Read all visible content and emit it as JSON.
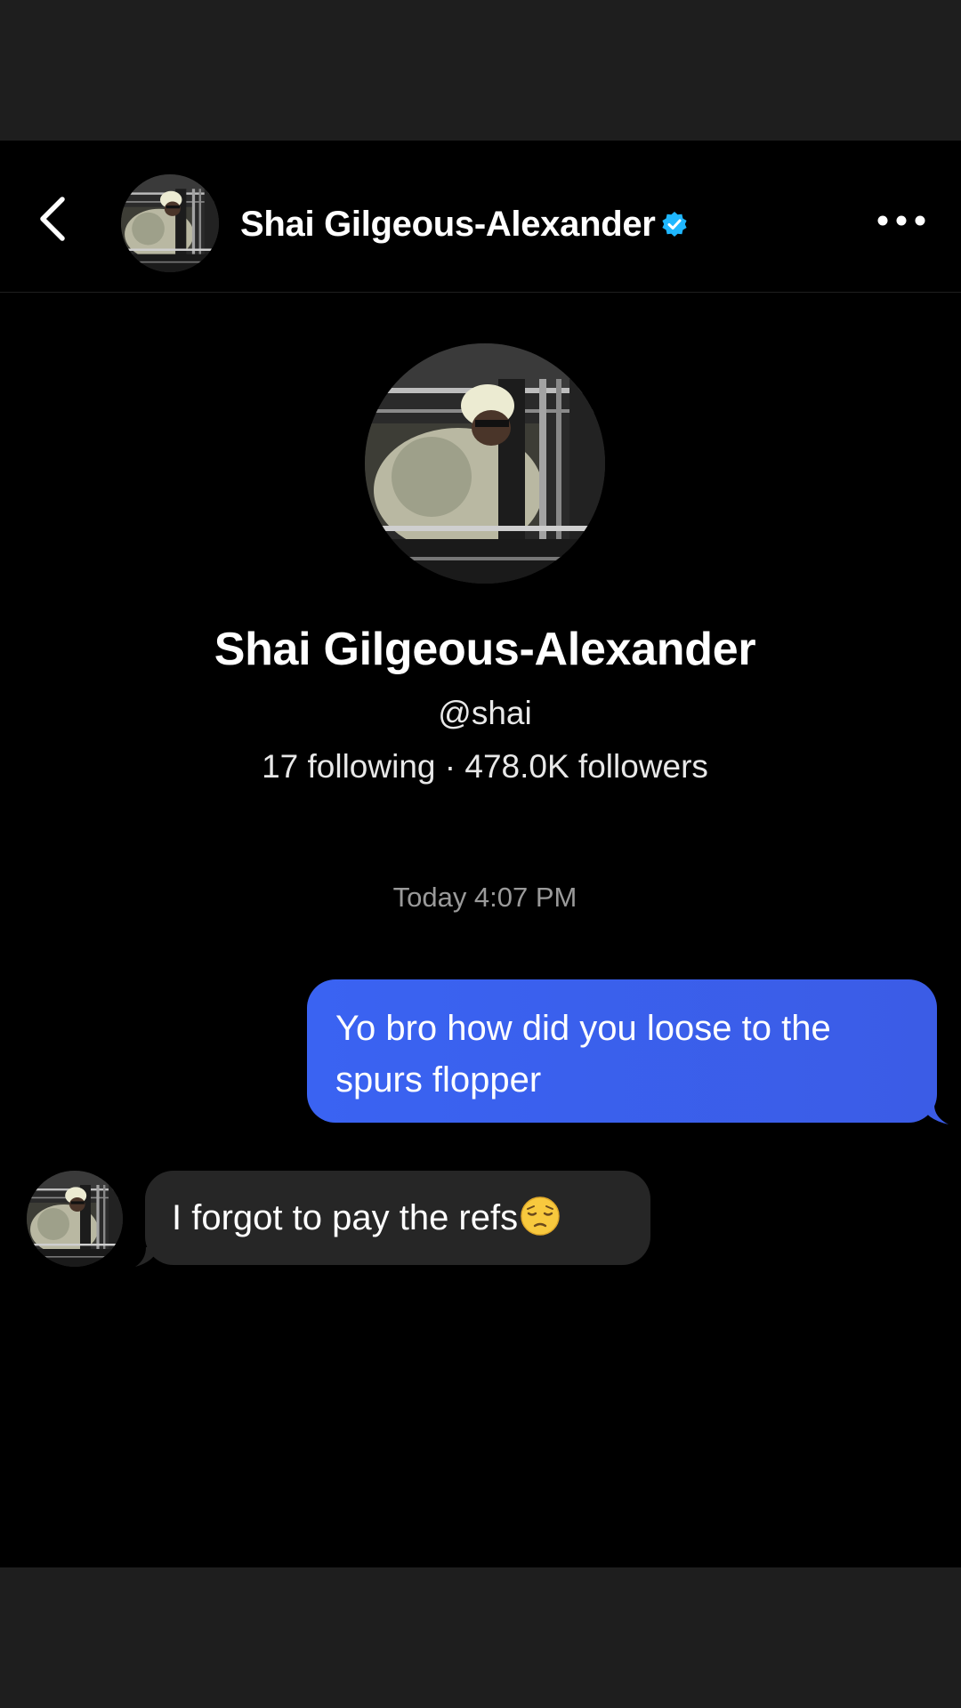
{
  "header": {
    "back_icon": "chevron-left-icon",
    "name": "Shai Gilgeous-Alexander",
    "verified_icon": "verified-badge-icon",
    "verified_color": "#1fb7ff",
    "more_icon": "more-horizontal-icon"
  },
  "profile": {
    "name": "Shai Gilgeous-Alexander",
    "handle": "@shai",
    "stats": "17 following · 478.0K followers"
  },
  "conversation": {
    "timestamp": "Today 4:07 PM",
    "messages": [
      {
        "direction": "sent",
        "text": "Yo bro how did you loose to the spurs flopper",
        "line1": "Yo bro how did you loose to the",
        "line2": "spurs flopper",
        "color": "#3a63f2"
      },
      {
        "direction": "received",
        "text": "I forgot to pay the refs",
        "emoji": "pensive-face-icon",
        "color": "#262626"
      }
    ]
  },
  "colors": {
    "background": "#000000",
    "letterbox": "#1e1e1e",
    "sent_bubble": "#3a63f2",
    "received_bubble": "#262626",
    "muted_text": "#9a9a9a"
  }
}
